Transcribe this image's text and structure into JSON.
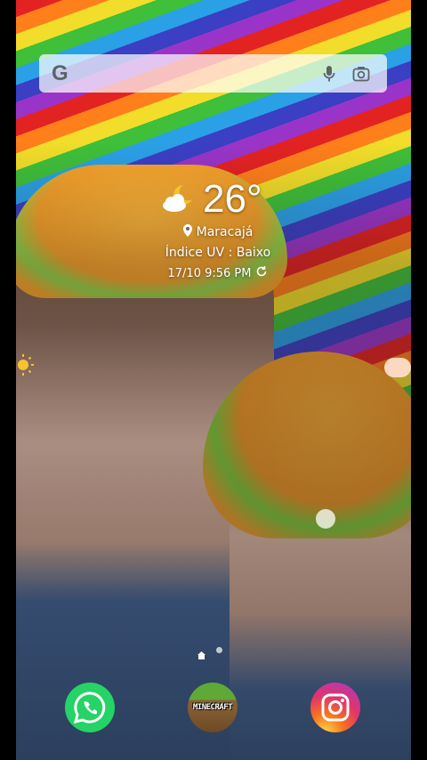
{
  "search": {
    "logo": "G",
    "placeholder": "",
    "mic_icon": "mic-icon",
    "lens_icon": "camera-lens-icon"
  },
  "weather": {
    "icon": "partly-cloudy-night-icon",
    "temperature": "26°",
    "location": "Maracajá",
    "uv": "Índice UV : Baixo",
    "datetime": "17/10 9:56 PM"
  },
  "pages": {
    "current": 1,
    "count": 2
  },
  "dock": {
    "apps": [
      {
        "name": "WhatsApp",
        "icon": "whatsapp-icon"
      },
      {
        "name": "Minecraft",
        "label": "MINECRAFT",
        "icon": "minecraft-icon"
      },
      {
        "name": "Instagram",
        "icon": "instagram-icon"
      }
    ]
  },
  "colors": {
    "whatsapp": "#25d366",
    "instagram_start": "#fdd54b",
    "instagram_end": "#6d45c8"
  }
}
